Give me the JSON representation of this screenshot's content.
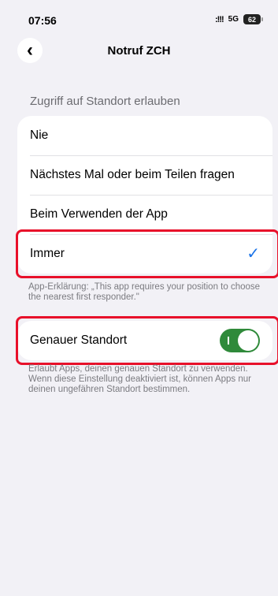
{
  "status_bar": {
    "time": "07:56",
    "signal": ":!!!",
    "network": "5G",
    "battery": "62"
  },
  "nav": {
    "back_icon": "chevron-left-icon",
    "title": "Notruf ZCH"
  },
  "location_access": {
    "header": "Zugriff auf Standort erlauben",
    "options": [
      {
        "label": "Nie",
        "selected": false
      },
      {
        "label": "Nächstes Mal oder beim Teilen fragen",
        "selected": false
      },
      {
        "label": "Beim Verwenden der App",
        "selected": false
      },
      {
        "label": "Immer",
        "selected": true
      }
    ],
    "explanation": "App-Erklärung: „This app requires your position to choose the nearest first responder.\""
  },
  "precise_location": {
    "label": "Genauer Standort",
    "enabled": true,
    "description": "Erlaubt Apps, deinen genauen Standort zu verwenden. Wenn diese Einstellung deaktiviert ist, können Apps nur deinen ungefähren Standort bestimmen."
  },
  "colors": {
    "background": "#f2f1f6",
    "accent": "#1a73e8",
    "toggle_on": "#2f8a3a",
    "highlight": "#e8102a"
  }
}
